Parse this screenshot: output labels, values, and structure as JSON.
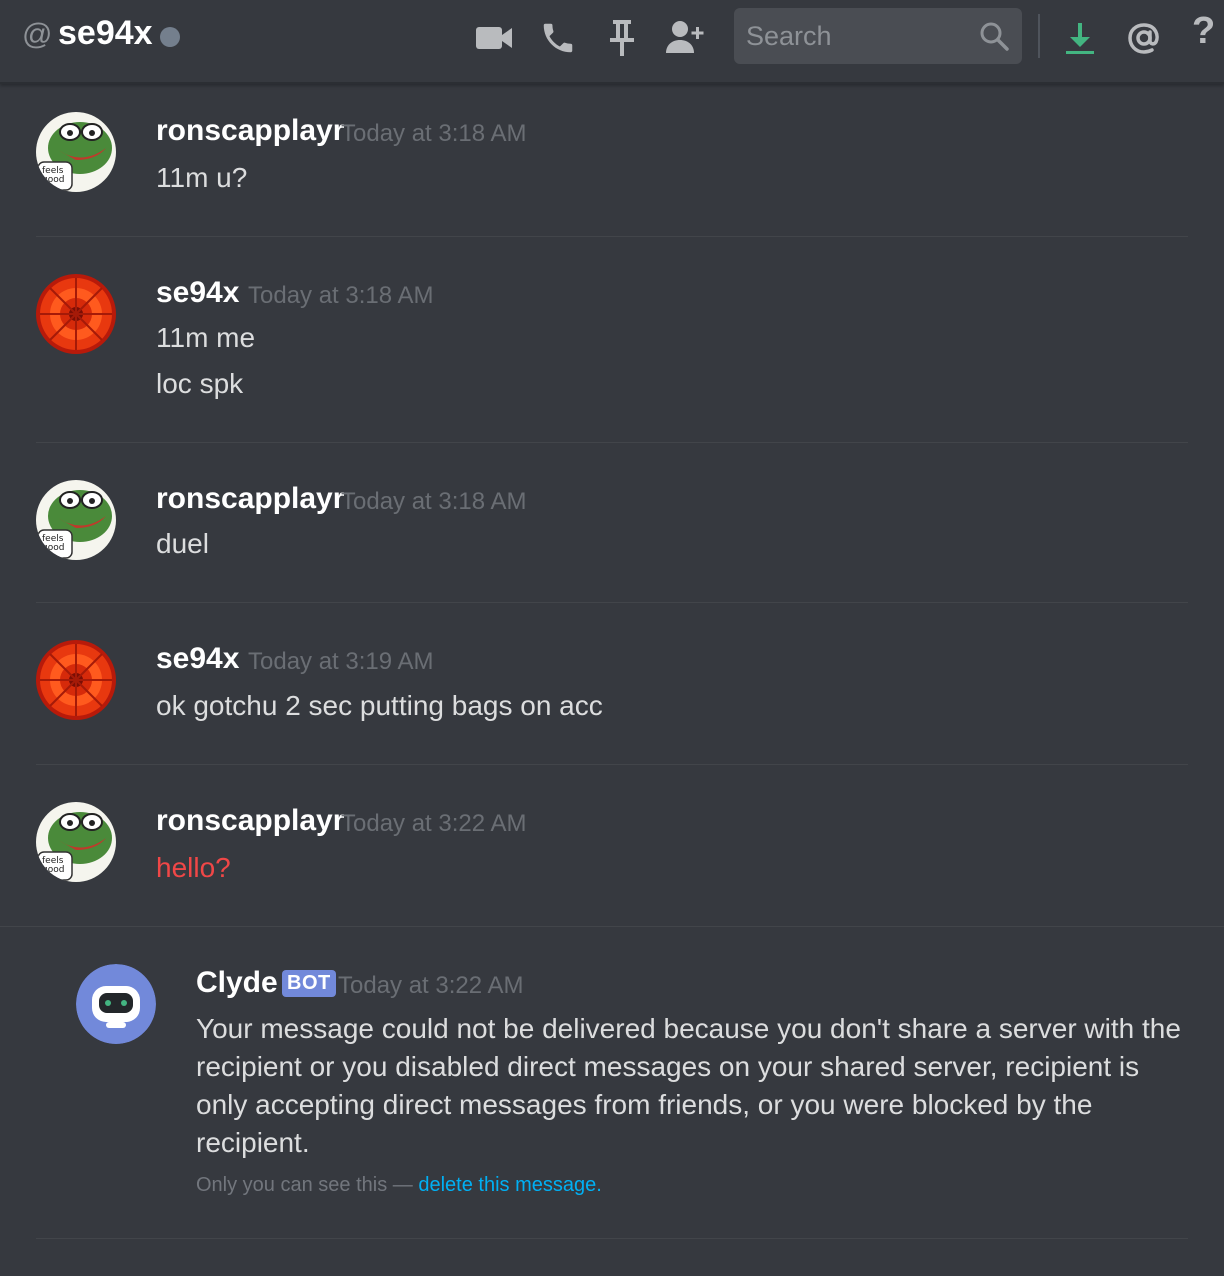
{
  "header": {
    "at_symbol": "@",
    "channel_name": "se94x",
    "status": "offline",
    "icons": [
      "video-camera-icon",
      "phone-icon",
      "pin-icon",
      "add-friend-icon"
    ],
    "search_placeholder": "Search",
    "right_icons": [
      "download-icon",
      "mention-icon",
      "help-icon"
    ],
    "help_label": "?"
  },
  "messages": [
    {
      "author": "ronscapplayr",
      "timestamp": "Today at 3:18 AM",
      "lines": [
        "11m u?"
      ],
      "avatar": "pepe-avatar"
    },
    {
      "author": "se94x",
      "timestamp": "Today at 3:18 AM",
      "lines": [
        "11m me",
        "loc spk"
      ],
      "avatar": "flower-avatar"
    },
    {
      "author": "ronscapplayr",
      "timestamp": "Today at 3:18 AM",
      "lines": [
        "duel"
      ],
      "avatar": "pepe-avatar"
    },
    {
      "author": "se94x",
      "timestamp": "Today at 3:19 AM",
      "lines": [
        "ok gotchu 2 sec putting bags on acc"
      ],
      "avatar": "flower-avatar"
    },
    {
      "author": "ronscapplayr",
      "timestamp": "Today at 3:22 AM",
      "lines": [
        "hello?"
      ],
      "avatar": "pepe-avatar",
      "failed": true
    }
  ],
  "bot_message": {
    "author": "Clyde",
    "badge": "BOT",
    "timestamp": "Today at 3:22 AM",
    "text": "Your message could not be delivered because you don't share a server with the recipient or you disabled direct messages on your shared server, recipient is only accepting direct messages from friends, or you were blocked by the recipient.",
    "ephemeral_note": "Only you can see this —",
    "delete_link": "delete this message",
    "delete_suffix": "."
  },
  "colors": {
    "background": "#36393f",
    "failed_text": "#f04747",
    "link": "#00b0f4",
    "bot_badge": "#7289da",
    "download_icon": "#43b581"
  }
}
